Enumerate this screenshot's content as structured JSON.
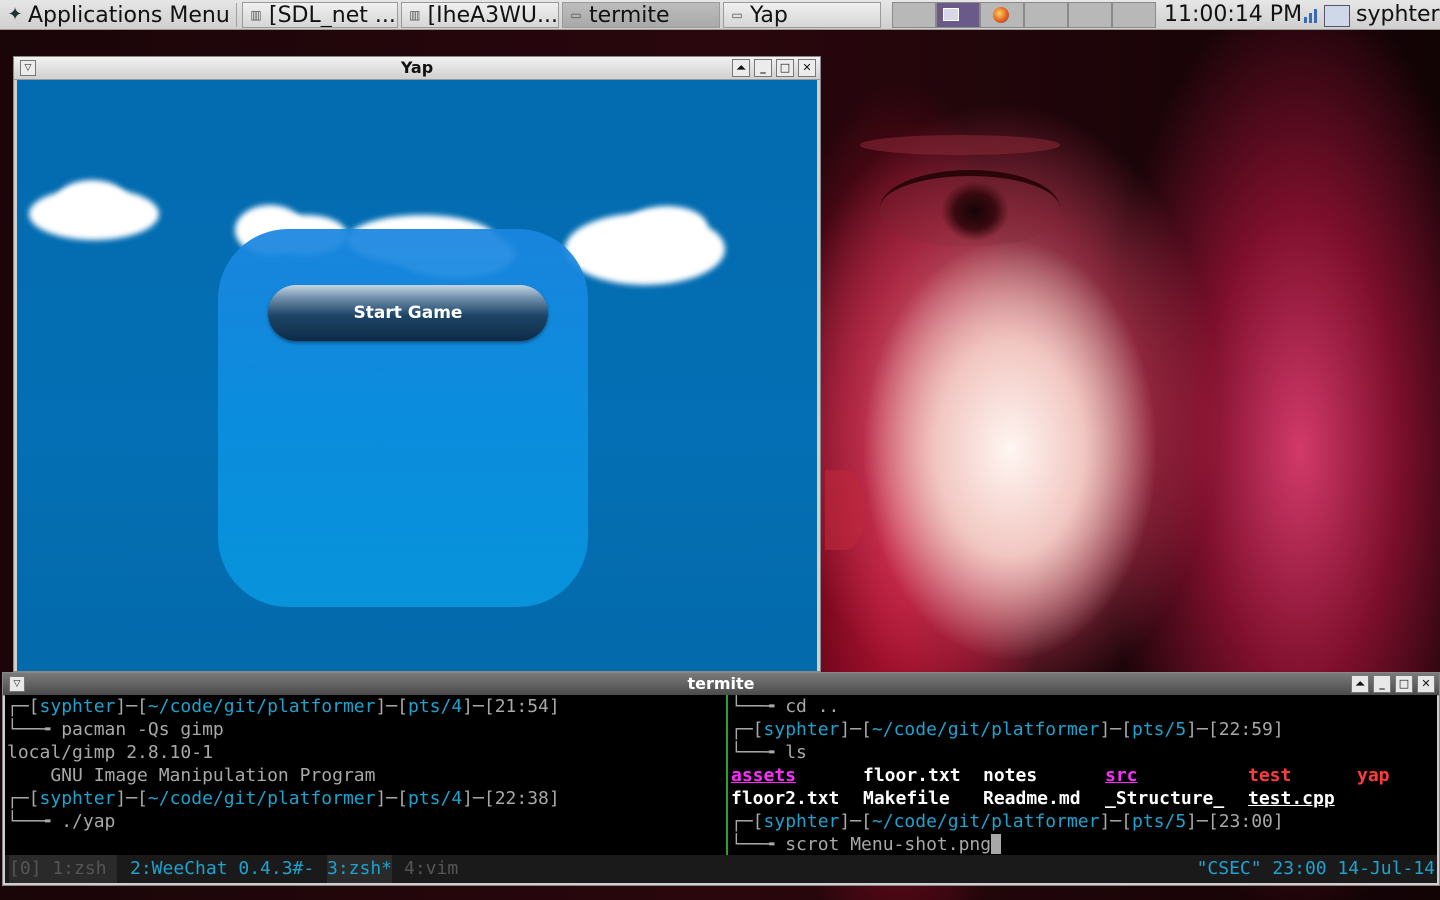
{
  "panel": {
    "app_menu_label": "Applications Menu",
    "tasks": [
      {
        "label": "[SDL_net ...",
        "active": false
      },
      {
        "label": "[IheA3WU...",
        "active": false
      },
      {
        "label": "termite",
        "active": true
      },
      {
        "label": "Yap",
        "active": false
      }
    ],
    "clock": "11:00:14 PM",
    "user": "syphter"
  },
  "yap_window": {
    "title": "Yap",
    "start_button_label": "Start Game"
  },
  "termite_window": {
    "title": "termite",
    "left_pane": {
      "prompt1": {
        "user": "syphter",
        "path": "~/code/git/platformer",
        "tty": "pts/4",
        "time": "21:54"
      },
      "cmd1": "pacman -Qs gimp",
      "out1": "local/gimp 2.8.10-1",
      "out2": "    GNU Image Manipulation Program",
      "prompt2": {
        "user": "syphter",
        "path": "~/code/git/platformer",
        "tty": "pts/4",
        "time": "22:38"
      },
      "cmd2": "./yap"
    },
    "right_pane": {
      "cmd0": "cd ..",
      "prompt1": {
        "user": "syphter",
        "path": "~/code/git/platformer",
        "tty": "pts/5",
        "time": "22:59"
      },
      "cmd1": "ls",
      "ls_row1": [
        "assets",
        "floor.txt",
        "notes",
        "src",
        "test",
        "yap"
      ],
      "ls_row2": [
        "floor2.txt",
        "Makefile",
        "Readme.md",
        "_Structure_",
        "test.cpp"
      ],
      "prompt2": {
        "user": "syphter",
        "path": "~/code/git/platformer",
        "tty": "pts/5",
        "time": "23:00"
      },
      "cmd2": "scrot Menu-shot.png"
    },
    "status": {
      "w0": "[0] 1:zsh ",
      "w2": "2:WeeChat 0.4.3#-",
      "w3": "3:zsh*",
      "w4": "4:vim",
      "right": "\"CSEC\" 23:00 14-Jul-14"
    }
  }
}
